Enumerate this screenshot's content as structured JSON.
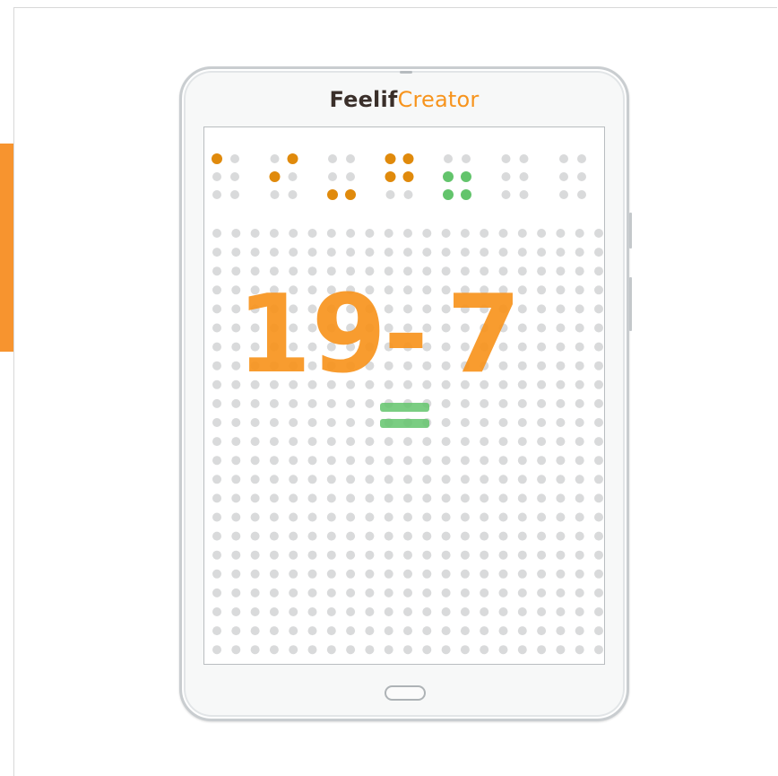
{
  "app": {
    "brand_primary": "Feelif",
    "brand_secondary": "Creator"
  },
  "colors": {
    "accent_orange": "#f7941d",
    "raised_orange": "#e08a0c",
    "raised_green": "#63c46c",
    "dot_idle": "#d9dadb"
  },
  "braille_header": {
    "cells": [
      {
        "dots": [
          1
        ]
      },
      {
        "dots": [
          2,
          4
        ]
      },
      {
        "dots": [
          3,
          6
        ]
      },
      {
        "dots": [
          1,
          2,
          4,
          5
        ]
      },
      {
        "dots": [
          2,
          3,
          5,
          6
        ],
        "color": "green"
      },
      {
        "dots": []
      },
      {
        "dots": []
      }
    ]
  },
  "expression": {
    "left_operand": "19",
    "operator": "-",
    "right_operand": "7",
    "equals": "="
  },
  "icons": {
    "home_button": "home-button-icon",
    "camera": "camera-icon"
  }
}
